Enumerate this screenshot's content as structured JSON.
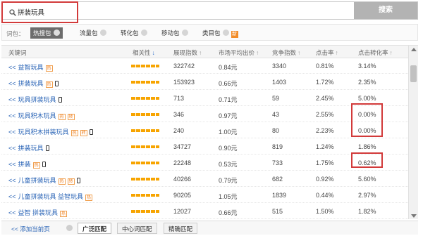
{
  "search": {
    "query": "拼装玩具",
    "button_label": "搜索"
  },
  "packs": {
    "label": "词包：",
    "items": [
      {
        "label": "热搜包",
        "active": true,
        "badge": ""
      },
      {
        "label": "流量包",
        "active": false,
        "badge": ""
      },
      {
        "label": "转化包",
        "active": false,
        "badge": ""
      },
      {
        "label": "移动包",
        "active": false,
        "badge": ""
      },
      {
        "label": "类目包",
        "active": false,
        "badge": "新"
      }
    ]
  },
  "table": {
    "headers": {
      "keyword": "关键词",
      "relevance": "相关性",
      "impressions": "展现指数",
      "avg_price": "市场平均出价",
      "competition": "竞争指数",
      "ctr": "点击率",
      "cvr": "点击转化率"
    },
    "rows": [
      {
        "arrows": "<<",
        "keyword": "益智玩具",
        "tags": [
          "热"
        ],
        "phone": false,
        "impressions": "322742",
        "avg_price": "0.84元",
        "competition": "3340",
        "ctr": "0.81%",
        "cvr": "3.14%"
      },
      {
        "arrows": "<<",
        "keyword": "拼装玩具",
        "tags": [
          "热"
        ],
        "phone": true,
        "impressions": "153923",
        "avg_price": "0.66元",
        "competition": "1403",
        "ctr": "1.72%",
        "cvr": "2.35%"
      },
      {
        "arrows": "<<",
        "keyword": "玩具拼装玩具",
        "tags": [],
        "phone": true,
        "impressions": "713",
        "avg_price": "0.71元",
        "competition": "59",
        "ctr": "2.45%",
        "cvr": "5.00%"
      },
      {
        "arrows": "<<",
        "keyword": "玩具积木玩具",
        "tags": [
          "热",
          "转"
        ],
        "phone": false,
        "impressions": "346",
        "avg_price": "0.97元",
        "competition": "43",
        "ctr": "2.55%",
        "cvr": "0.00%"
      },
      {
        "arrows": "<<",
        "keyword": "玩具积木拼装玩具",
        "tags": [
          "热",
          "转"
        ],
        "phone": true,
        "impressions": "240",
        "avg_price": "1.00元",
        "competition": "80",
        "ctr": "2.23%",
        "cvr": "0.00%"
      },
      {
        "arrows": "<<",
        "keyword": "拼装玩具",
        "tags": [],
        "phone": true,
        "impressions": "34727",
        "avg_price": "0.90元",
        "competition": "819",
        "ctr": "1.24%",
        "cvr": "1.86%"
      },
      {
        "arrows": "<<",
        "keyword": "拼装",
        "tags": [
          "热"
        ],
        "phone": true,
        "impressions": "22248",
        "avg_price": "0.53元",
        "competition": "733",
        "ctr": "1.75%",
        "cvr": "0.62%"
      },
      {
        "arrows": "<<",
        "keyword": "儿童拼装玩具",
        "tags": [
          "热",
          "转"
        ],
        "phone": true,
        "impressions": "40266",
        "avg_price": "0.79元",
        "competition": "682",
        "ctr": "0.92%",
        "cvr": "5.60%"
      },
      {
        "arrows": "<<",
        "keyword": "儿童拼装玩具 益智玩具",
        "tags": [
          "热"
        ],
        "phone": false,
        "impressions": "90205",
        "avg_price": "1.05元",
        "competition": "1839",
        "ctr": "0.44%",
        "cvr": "2.97%"
      },
      {
        "arrows": "<<",
        "keyword": "益智 拼装玩具",
        "tags": [
          "热"
        ],
        "phone": false,
        "impressions": "12027",
        "avg_price": "0.66元",
        "competition": "515",
        "ctr": "1.50%",
        "cvr": "1.82%"
      }
    ]
  },
  "footer": {
    "add_link": "<< 添加当前页",
    "tabs": [
      "广泛匹配",
      "中心词匹配",
      "精确匹配"
    ],
    "active_tab": 0
  },
  "colors": {
    "highlight": "#d23a3a",
    "link": "#2762b5",
    "relevance_bar": "#f7a400",
    "tag": "#f08020"
  }
}
